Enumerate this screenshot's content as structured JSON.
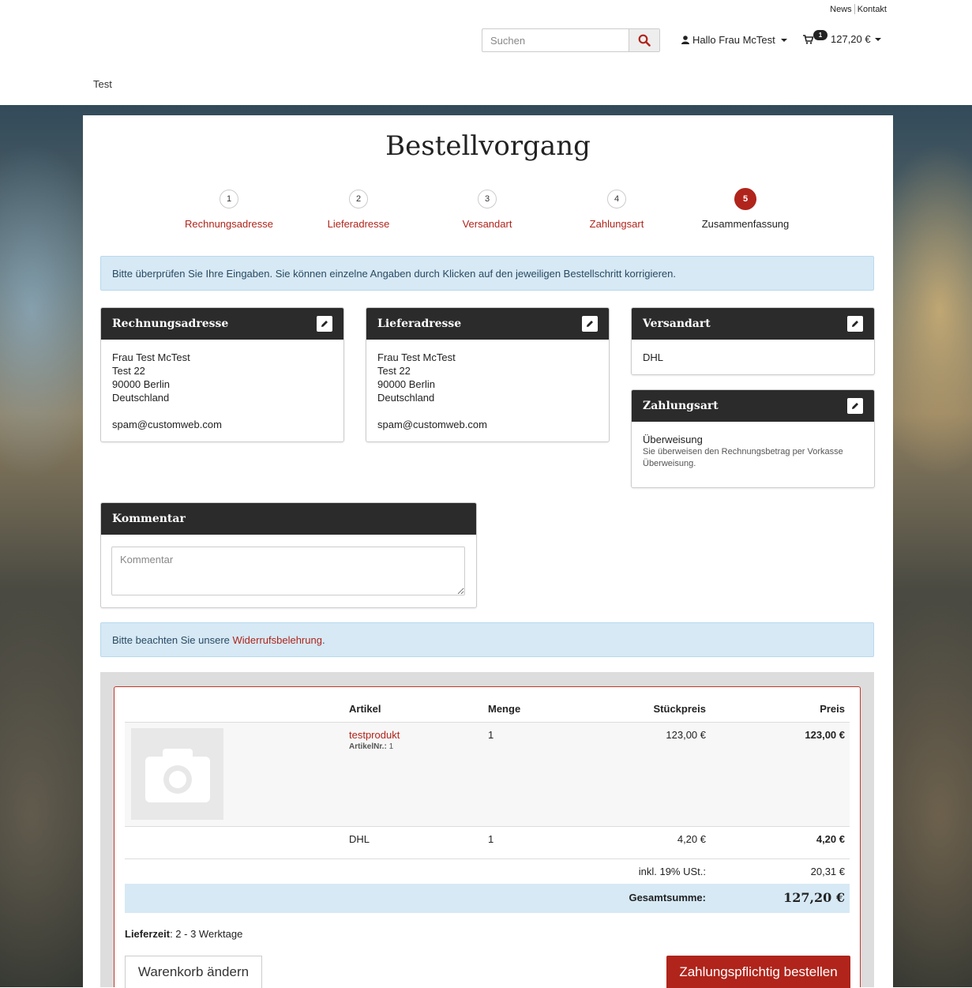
{
  "header": {
    "top_links": [
      "News",
      "Kontakt"
    ],
    "search": {
      "placeholder": "Suchen"
    },
    "user_label": "Hallo Frau McTest",
    "cart": {
      "count": "1",
      "total": "127,20 €"
    },
    "nav_item": "Test"
  },
  "page_title": "Bestellvorgang",
  "steps": [
    {
      "num": "1",
      "label": "Rechnungsadresse"
    },
    {
      "num": "2",
      "label": "Lieferadresse"
    },
    {
      "num": "3",
      "label": "Versandart"
    },
    {
      "num": "4",
      "label": "Zahlungsart"
    },
    {
      "num": "5",
      "label": "Zusammenfassung"
    }
  ],
  "info_alert": "Bitte überprüfen Sie Ihre Eingaben. Sie können einzelne Angaben durch Klicken auf den jeweiligen Bestellschritt korrigieren.",
  "billing": {
    "title": "Rechnungsadresse",
    "name": "Frau Test McTest",
    "street": "Test 22",
    "city": "90000 Berlin",
    "country": "Deutschland",
    "email": "spam@customweb.com"
  },
  "shipping": {
    "title": "Lieferadresse",
    "name": "Frau Test McTest",
    "street": "Test 22",
    "city": "90000 Berlin",
    "country": "Deutschland",
    "email": "spam@customweb.com"
  },
  "shipping_method": {
    "title": "Versandart",
    "value": "DHL"
  },
  "payment": {
    "title": "Zahlungsart",
    "value": "Überweisung",
    "description": "Sie überweisen den Rechnungsbetrag per Vorkasse Überweisung."
  },
  "comment": {
    "title": "Kommentar",
    "placeholder": "Kommentar"
  },
  "withdrawal_notice": {
    "prefix": "Bitte beachten Sie unsere ",
    "link": "Widerrufsbelehrung",
    "suffix": "."
  },
  "cart_table": {
    "headers": {
      "article": "Artikel",
      "qty": "Menge",
      "unit_price": "Stückpreis",
      "price": "Preis"
    },
    "product": {
      "name": "testprodukt",
      "sku_label": "ArtikelNr.:",
      "sku": "1",
      "qty": "1",
      "unit_price": "123,00 €",
      "price": "123,00 €"
    },
    "shipping_row": {
      "name": "DHL",
      "qty": "1",
      "unit_price": "4,20 €",
      "price": "4,20 €"
    },
    "tax": {
      "label": "inkl. 19% USt.:",
      "value": "20,31 €"
    },
    "total": {
      "label": "Gesamtsumme:",
      "value": "127,20 €"
    }
  },
  "delivery": {
    "label": "Lieferzeit",
    "value": ": 2 - 3 Werktage"
  },
  "buttons": {
    "change_cart": "Warenkorb ändern",
    "order": "Zahlungspflichtig bestellen"
  },
  "colors": {
    "accent": "#b0241b",
    "dark_header": "#2b2b2b",
    "info_bg": "#d6e9f5"
  }
}
